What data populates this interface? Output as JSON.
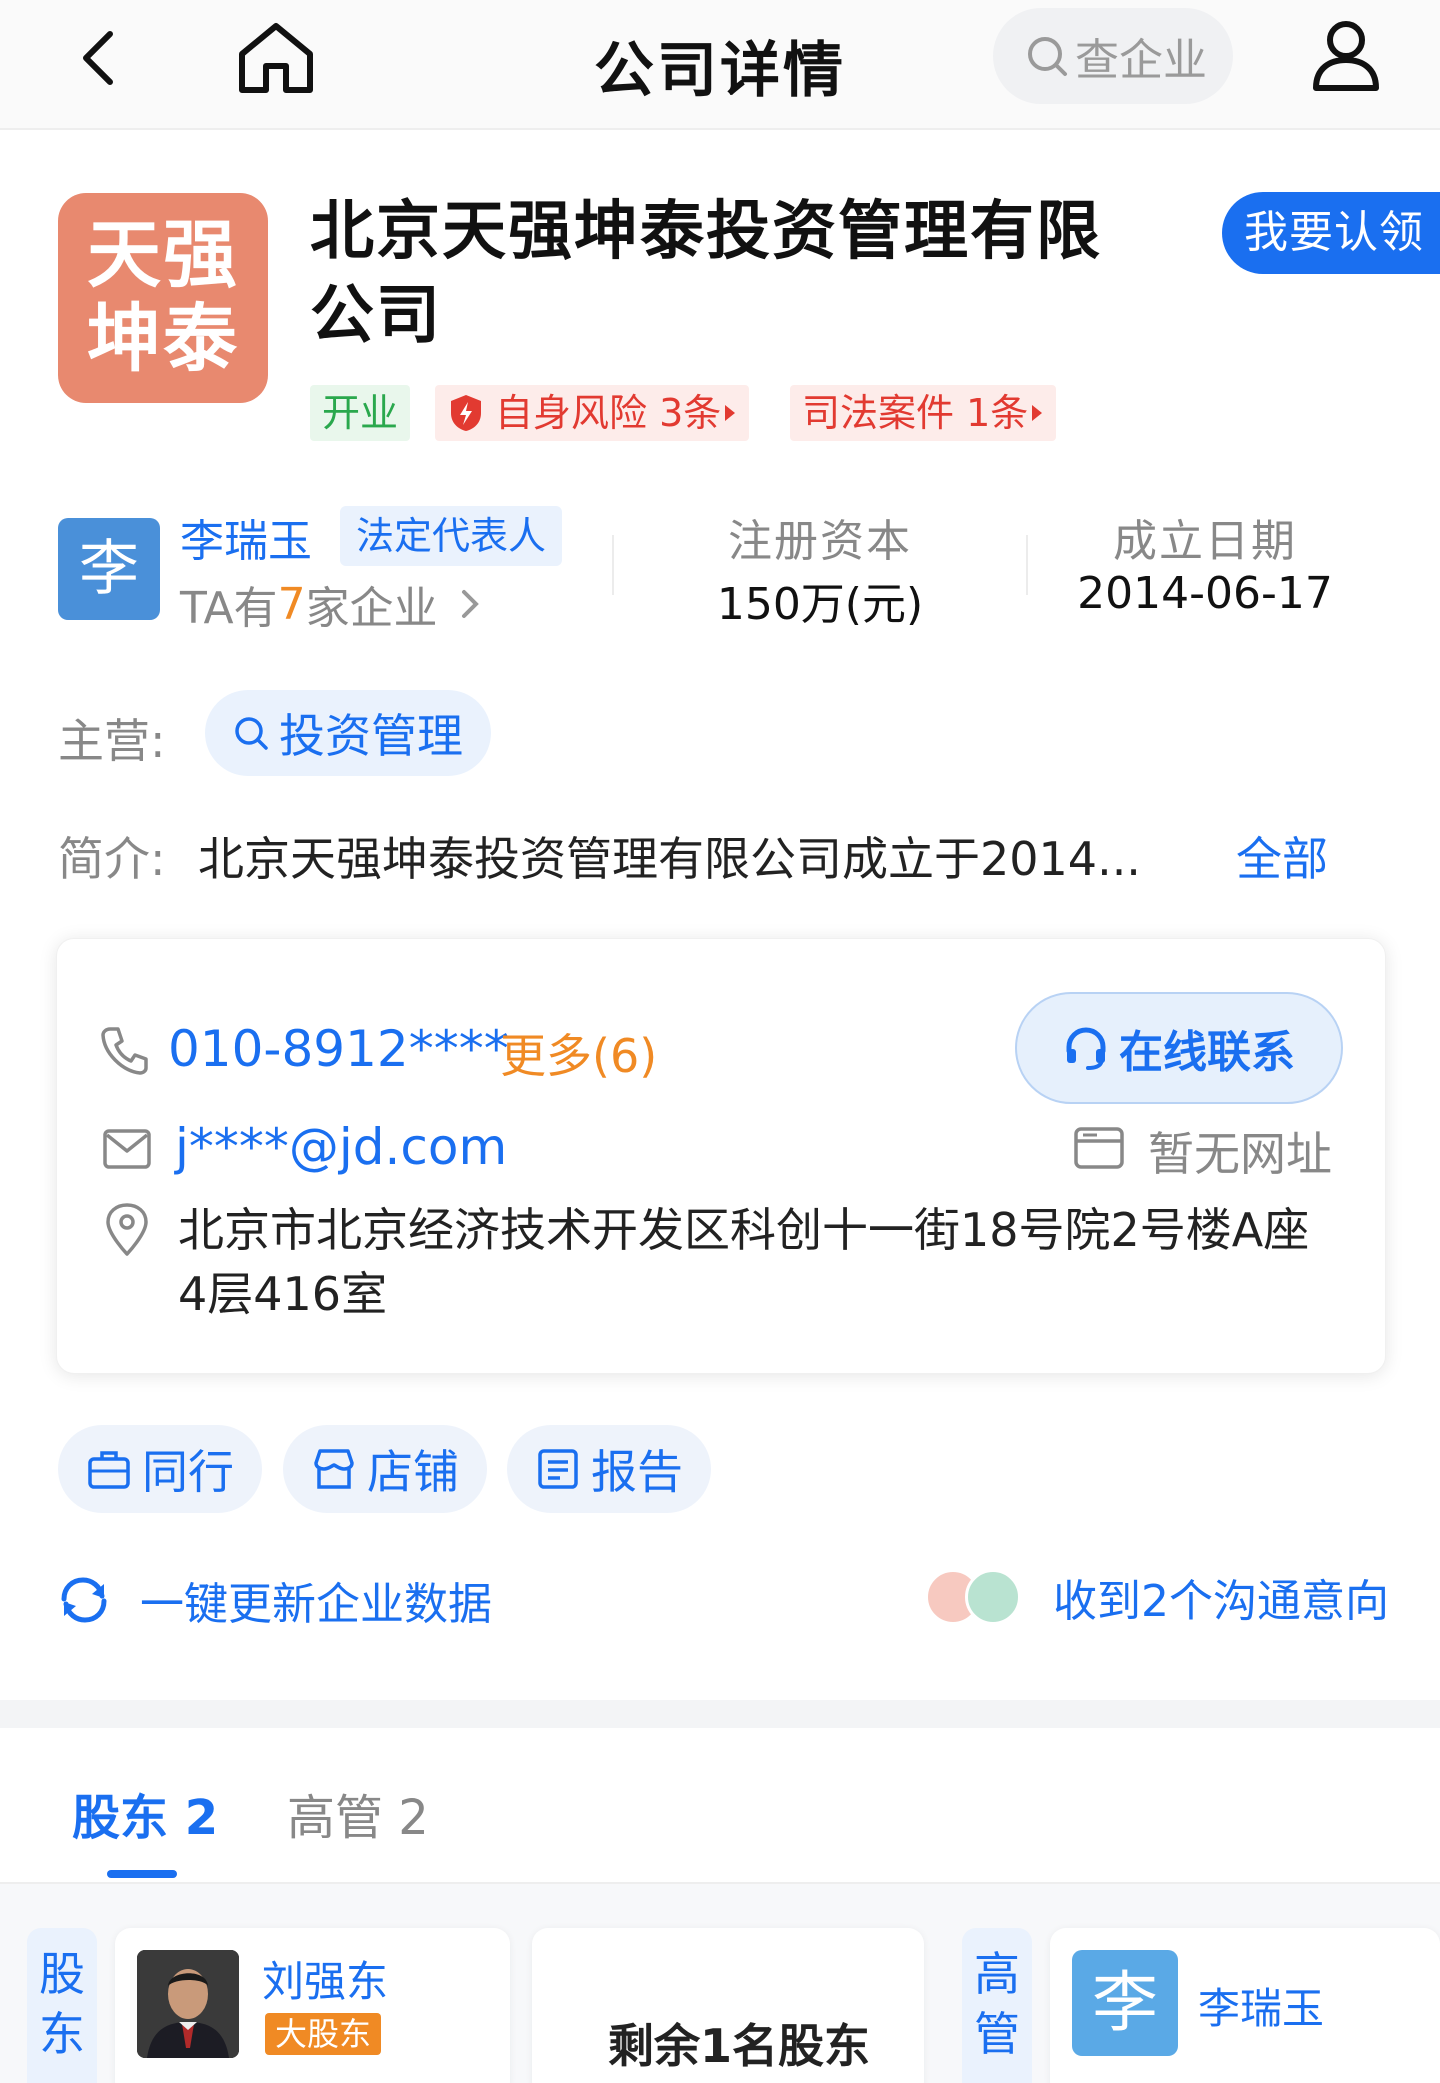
{
  "header": {
    "title": "公司详情",
    "search_placeholder": "查企业"
  },
  "company": {
    "logo_text_line1": "天强",
    "logo_text_line2": "坤泰",
    "name": "北京天强坤泰投资管理有限公司",
    "claim_label": "我要认领",
    "tags": {
      "status": "开业",
      "risk": "自身风险 3条",
      "law": "司法案件 1条"
    }
  },
  "legal_rep": {
    "avatar_char": "李",
    "name": "李瑞玉",
    "role": "法定代表人",
    "count_prefix": "TA有",
    "count_num": "7",
    "count_suffix": "家企业"
  },
  "stats": {
    "capital_label": "注册资本",
    "capital_value": "150万(元)",
    "founded_label": "成立日期",
    "founded_value": "2014-06-17"
  },
  "business": {
    "main_label": "主营:",
    "main_value": "投资管理",
    "intro_label": "简介:",
    "intro_text": "北京天强坤泰投资管理有限公司成立于2014...",
    "intro_all": "全部"
  },
  "contact": {
    "phone": "010-8912****",
    "phone_more": "更多(6)",
    "online_label": "在线联系",
    "email": "j****@jd.com",
    "website": "暂无网址",
    "address": "北京市北京经济技术开发区科创十一街18号院2号楼A座4层416室"
  },
  "actions": {
    "peers": "同行",
    "shops": "店铺",
    "report": "报告",
    "refresh": "一键更新企业数据",
    "intent": "收到2个沟通意向"
  },
  "tabs": {
    "shareholders": "股东 2",
    "executives": "高管 2"
  },
  "bottom": {
    "shareholder_label_1": "股",
    "shareholder_label_2": "东",
    "shareholder_name": "刘强东",
    "shareholder_badge": "大股东",
    "more_shareholders": "剩余1名股东",
    "executive_label_1": "高",
    "executive_label_2": "管",
    "executive_avatar_char": "李",
    "executive_name": "李瑞玉"
  },
  "colors": {
    "accent": "#1a6ff0",
    "logo_bg": "#e8896f",
    "risk_red": "#e23a31",
    "open_green": "#2aa84d",
    "orange": "#f08a24"
  }
}
